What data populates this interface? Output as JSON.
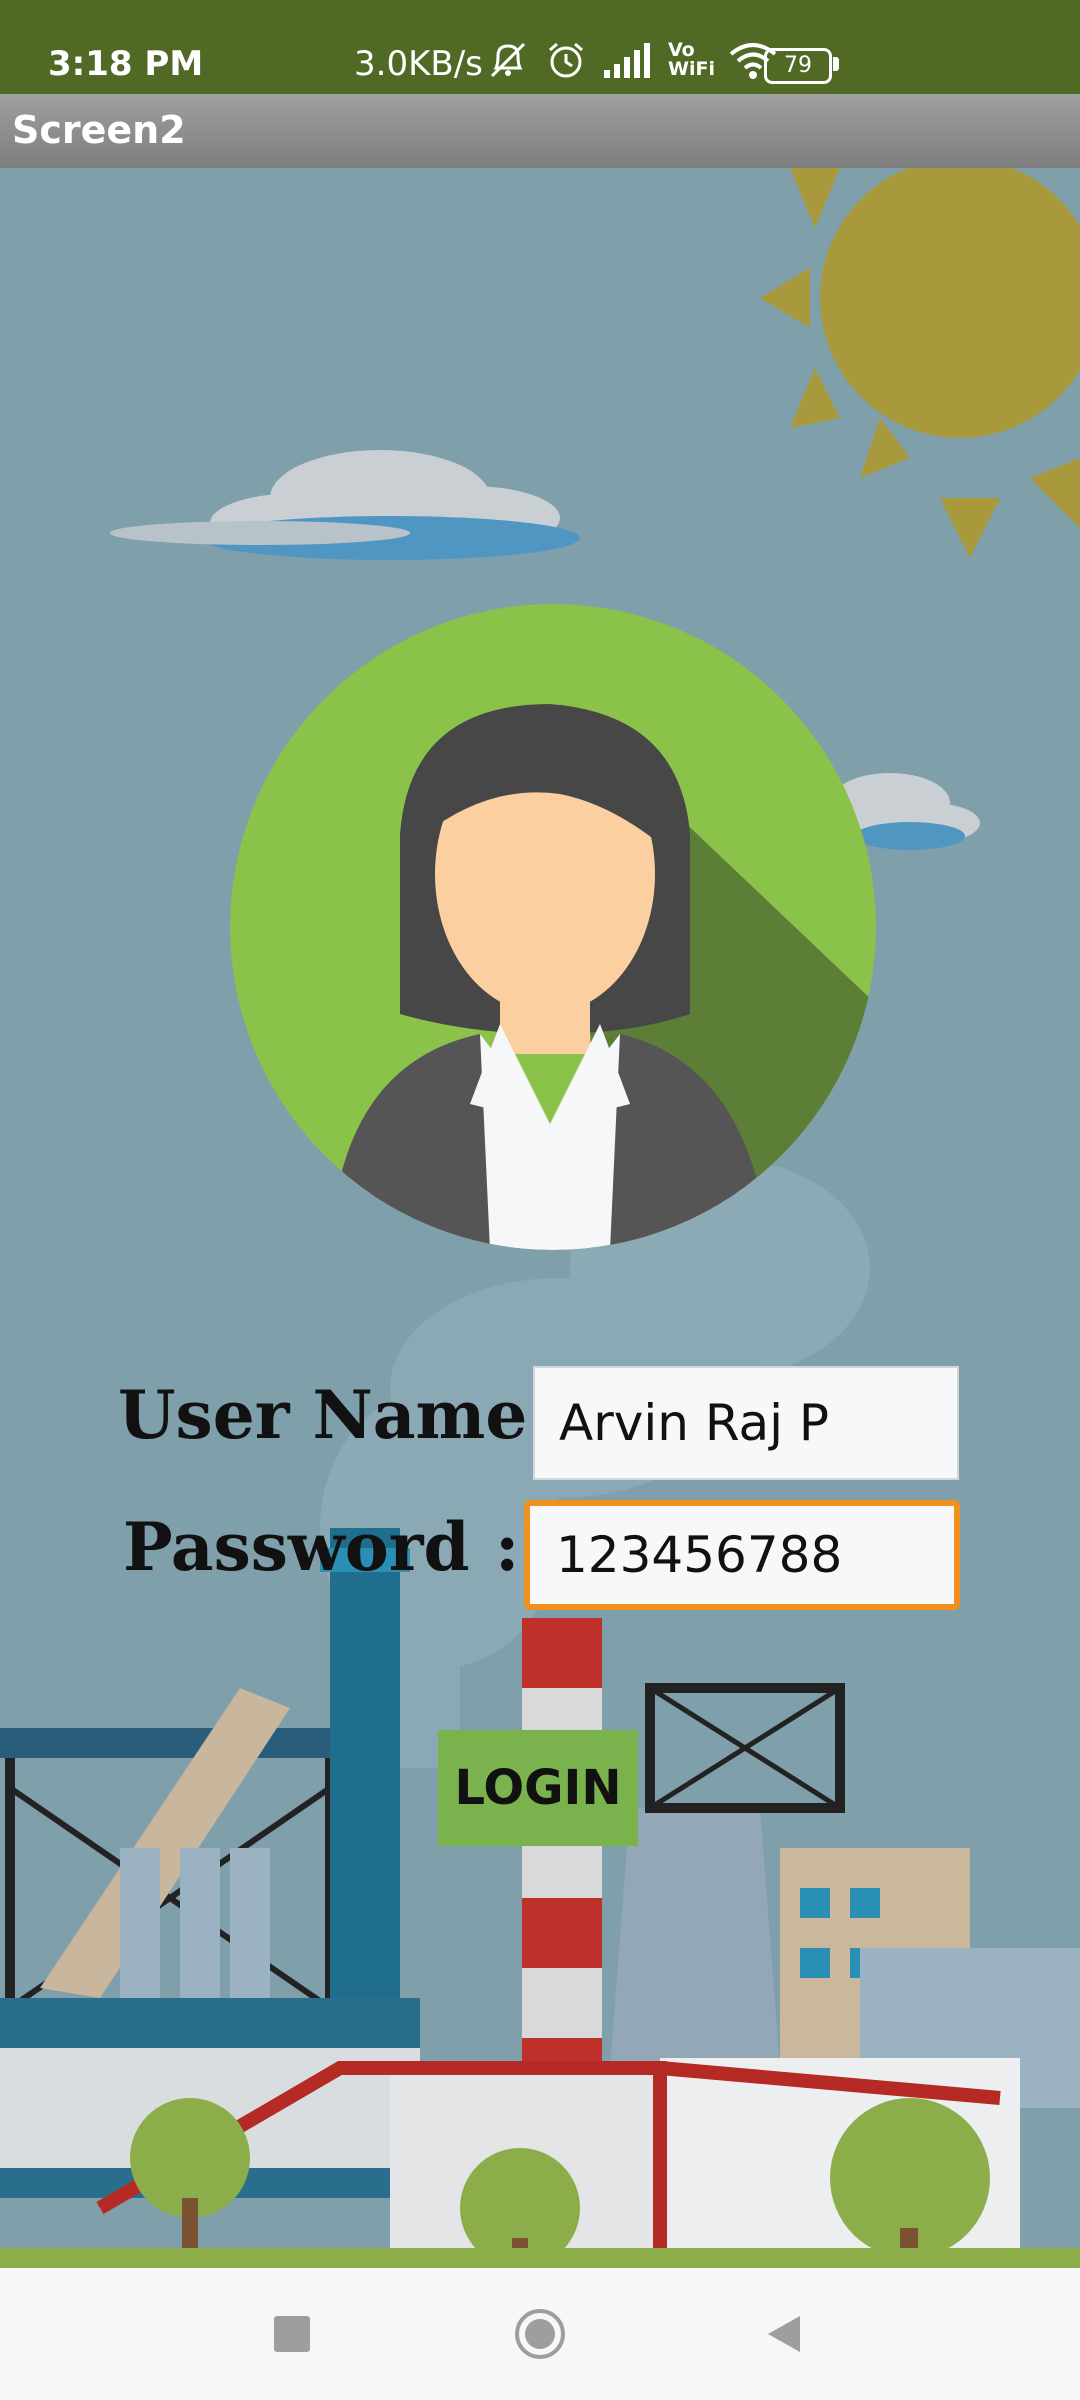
{
  "status_bar": {
    "time": "3:18 PM",
    "speed": "3.0KB/s",
    "battery": "79",
    "icons": [
      "mute-bell-icon",
      "alarm-icon",
      "signal-icon",
      "vowifi-icon",
      "wifi-icon",
      "battery-icon"
    ],
    "vowifi_label": "Vo WiFi"
  },
  "title_bar": {
    "title": "Screen2"
  },
  "form": {
    "username_label": "User Name :",
    "username_value": "Arvin Raj P",
    "password_label": "Password",
    "password_colon": ":",
    "password_value": "123456788"
  },
  "login": {
    "label": "LOGIN"
  },
  "colors": {
    "status_bar": "#506925",
    "sky": "#7f9fab",
    "avatar_circle": "#8bc34a",
    "login_button": "#7ab24e",
    "focus_border": "#f0901e"
  },
  "nav_bar": {
    "icons": [
      "square-recents-icon",
      "circle-home-icon",
      "triangle-back-icon"
    ]
  }
}
